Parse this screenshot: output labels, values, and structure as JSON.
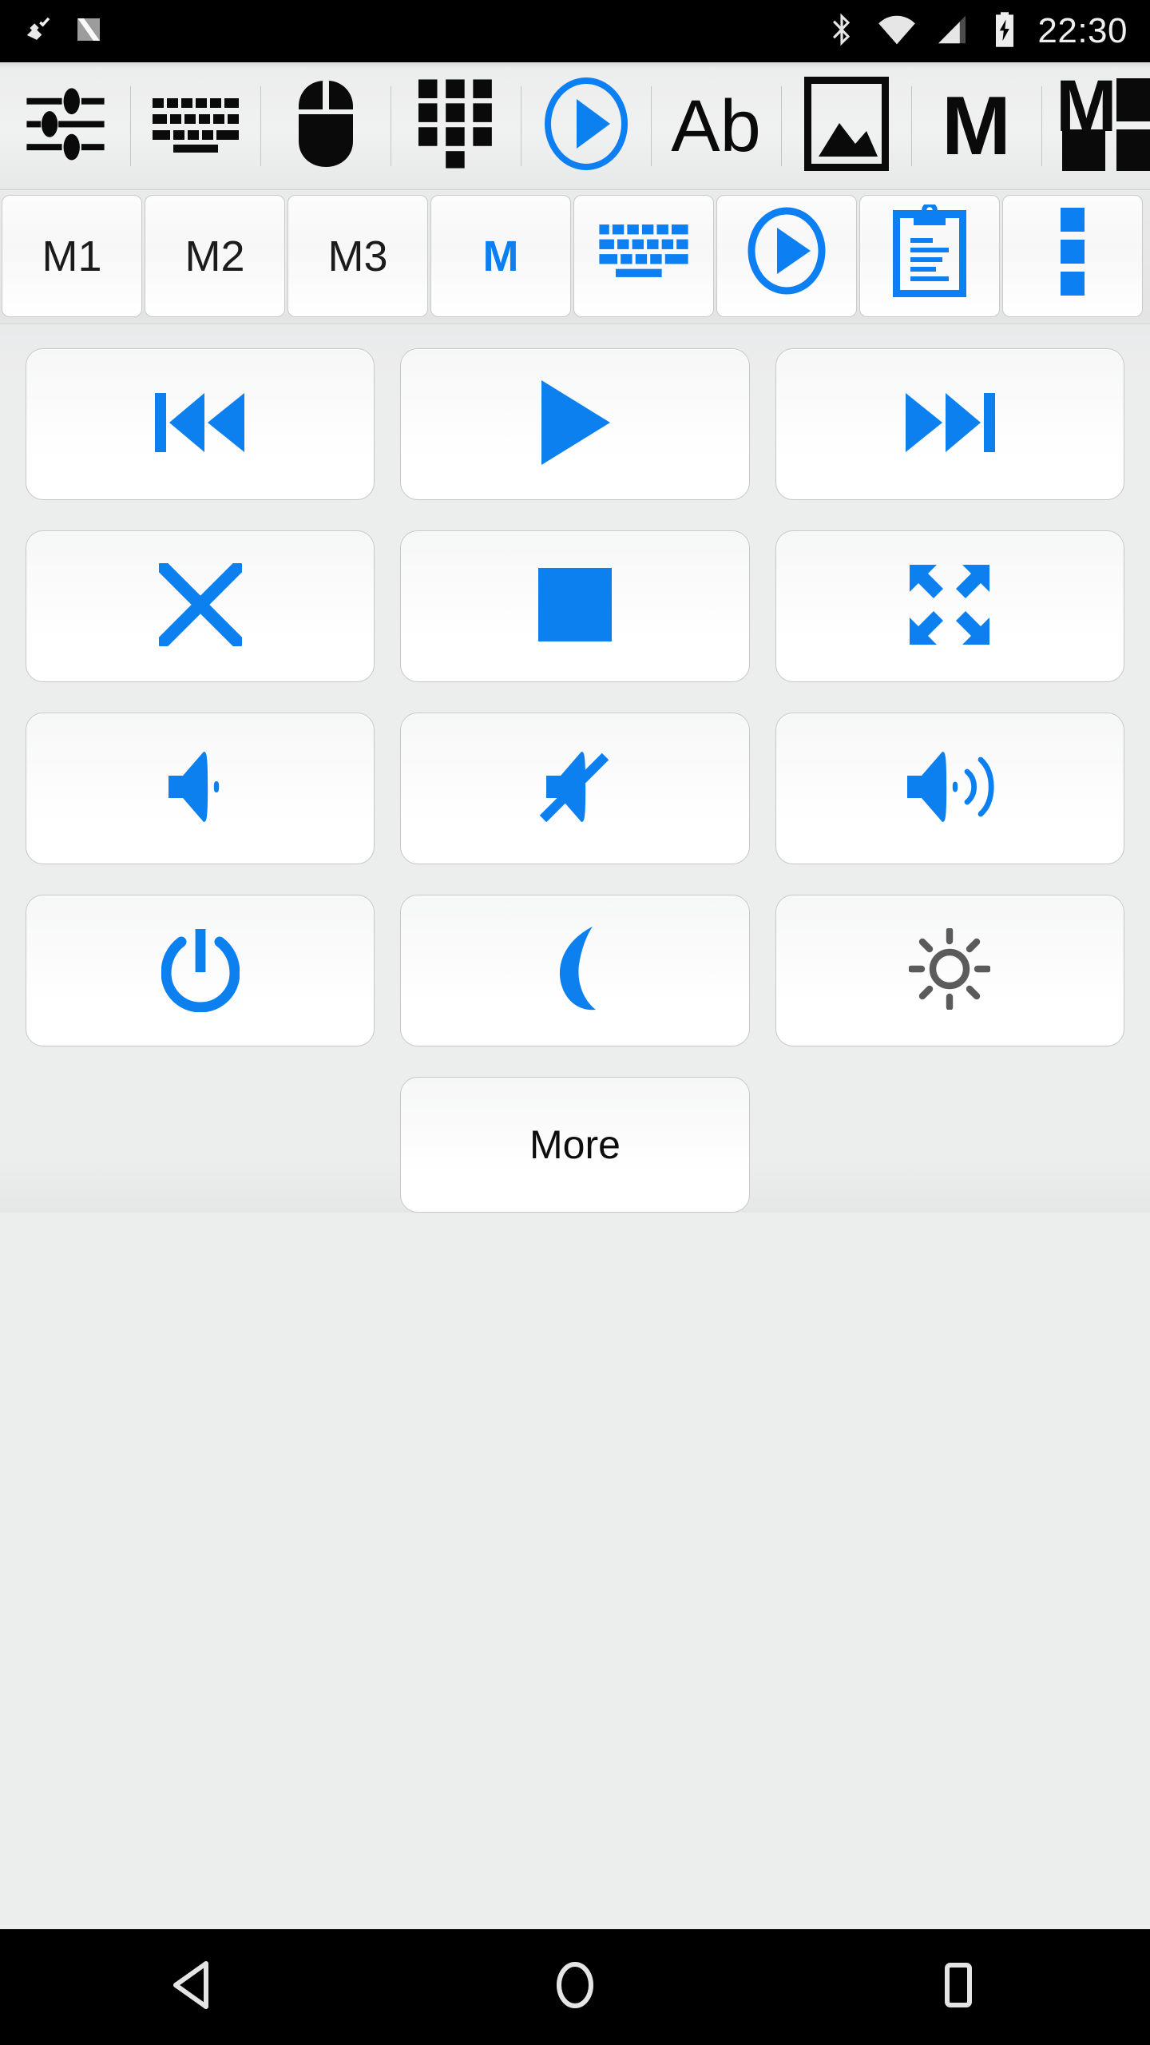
{
  "status_bar": {
    "time": "22:30",
    "left_icons": [
      {
        "name": "usb-debug-icon",
        "glyph": "usb-debug"
      },
      {
        "name": "android-nougat-icon",
        "glyph": "letter-n"
      }
    ],
    "right_icons": [
      {
        "name": "bluetooth-icon",
        "glyph": "bluetooth"
      },
      {
        "name": "wifi-icon",
        "glyph": "wifi"
      },
      {
        "name": "cellular-signal-icon",
        "glyph": "signal"
      },
      {
        "name": "battery-charging-icon",
        "glyph": "battery-charging"
      }
    ]
  },
  "toolbar": {
    "items": [
      {
        "name": "sliders-icon",
        "label": "Sliders",
        "color": "#0a0a0a"
      },
      {
        "name": "keyboard-icon",
        "label": "Keyboard",
        "color": "#0a0a0a"
      },
      {
        "name": "mouse-icon",
        "label": "Mouse",
        "color": "#0a0a0a"
      },
      {
        "name": "numpad-icon",
        "label": "Numpad",
        "color": "#0a0a0a"
      },
      {
        "name": "media-play-circle-icon",
        "label": "Media",
        "color": "#0c80f2"
      },
      {
        "name": "text-ab-icon",
        "label": "Ab",
        "color": "#0a0a0a"
      },
      {
        "name": "image-icon",
        "label": "Image",
        "color": "#0a0a0a"
      },
      {
        "name": "macro-m-icon",
        "label": "M",
        "color": "#0a0a0a"
      },
      {
        "name": "macro-grid-icon",
        "label": "M grid",
        "color": "#0a0a0a"
      }
    ]
  },
  "tabs": {
    "items": [
      {
        "name": "tab-m1",
        "label": "M1",
        "type": "text",
        "accent": false
      },
      {
        "name": "tab-m2",
        "label": "M2",
        "type": "text",
        "accent": false
      },
      {
        "name": "tab-m3",
        "label": "M3",
        "type": "text",
        "accent": false
      },
      {
        "name": "tab-macro",
        "label": "M",
        "type": "text",
        "accent": true
      },
      {
        "name": "tab-keyboard",
        "label": "Keyboard",
        "type": "icon",
        "icon": "keyboard-icon",
        "accent": true
      },
      {
        "name": "tab-media",
        "label": "Media",
        "type": "icon",
        "icon": "media-play-circle-icon",
        "accent": true
      },
      {
        "name": "tab-clipboard",
        "label": "Clipboard",
        "type": "icon",
        "icon": "clipboard-icon",
        "accent": true
      },
      {
        "name": "tab-overflow",
        "label": "More options",
        "type": "icon",
        "icon": "dots-vertical-icon",
        "accent": true
      }
    ]
  },
  "main": {
    "buttons": [
      {
        "name": "button-previous",
        "label": "Previous",
        "icon": "skip-previous-icon",
        "color": "#0d80f0"
      },
      {
        "name": "button-play",
        "label": "Play",
        "icon": "play-icon",
        "color": "#0d80f0"
      },
      {
        "name": "button-next",
        "label": "Next",
        "icon": "skip-next-icon",
        "color": "#0d80f0"
      },
      {
        "name": "button-close",
        "label": "Close",
        "icon": "close-x-icon",
        "color": "#0d80f0"
      },
      {
        "name": "button-stop",
        "label": "Stop",
        "icon": "stop-square-icon",
        "color": "#0d80f0"
      },
      {
        "name": "button-fullscreen",
        "label": "Fullscreen",
        "icon": "fullscreen-expand-icon",
        "color": "#0d80f0"
      },
      {
        "name": "button-volume-down",
        "label": "Volume Down",
        "icon": "volume-low-icon",
        "color": "#0d80f0"
      },
      {
        "name": "button-mute",
        "label": "Mute",
        "icon": "volume-mute-icon",
        "color": "#0d80f0"
      },
      {
        "name": "button-volume-up",
        "label": "Volume Up",
        "icon": "volume-high-icon",
        "color": "#0d80f0"
      },
      {
        "name": "button-power",
        "label": "Power",
        "icon": "power-icon",
        "color": "#0d80f0"
      },
      {
        "name": "button-sleep",
        "label": "Sleep",
        "icon": "moon-icon",
        "color": "#0d80f0"
      },
      {
        "name": "button-brightness",
        "label": "Brightness",
        "icon": "sun-icon",
        "color": "#5b5b5b"
      }
    ],
    "more_label": "More"
  },
  "nav_bar": {
    "items": [
      {
        "name": "nav-back-button",
        "label": "Back",
        "icon": "triangle-left-icon"
      },
      {
        "name": "nav-home-button",
        "label": "Home",
        "icon": "circle-icon"
      },
      {
        "name": "nav-recents-button",
        "label": "Recents",
        "icon": "square-icon"
      }
    ]
  },
  "colors": {
    "accent": "#0d80f0",
    "accent_tab": "#0c80f2",
    "icon_dark": "#0a0a0a",
    "icon_gray": "#5b5b5b",
    "page_bg": "#eceded",
    "bar_bg": "#000000"
  }
}
